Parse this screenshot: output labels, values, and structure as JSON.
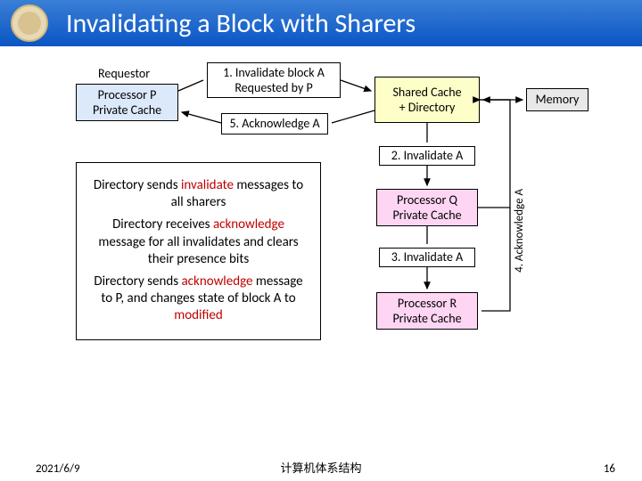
{
  "header": {
    "title": "Invalidating a Block with Sharers"
  },
  "requestor_label": "Requestor",
  "processor_p": {
    "l1": "Processor P",
    "l2": "Private Cache"
  },
  "shared_cache": {
    "l1": "Shared Cache",
    "l2": "+ Directory"
  },
  "memory": {
    "l1": "Memory"
  },
  "processor_q": {
    "l1": "Processor Q",
    "l2": "Private Cache"
  },
  "processor_r": {
    "l1": "Processor R",
    "l2": "Private Cache"
  },
  "labels": {
    "msg1a": "1. Invalidate block A",
    "msg1b": "Requested by P",
    "msg5": "5. Acknowledge A",
    "msg2": "2. Invalidate A",
    "msg3": "3. Invalidate A",
    "msg4": "4. Acknowledge  A"
  },
  "description": {
    "p1a": "Directory sends ",
    "p1b": "invalidate",
    "p1c": " messages to all sharers",
    "p2a": "Directory receives ",
    "p2b": "acknowledge",
    "p2c": " message for all invalidates and clears their presence bits",
    "p3a": "Directory sends ",
    "p3b": "acknowledge",
    "p3c": " message to P, and changes state of block A to ",
    "p3d": "modified"
  },
  "footer": {
    "date": "2021/6/9",
    "center": "计算机体系结构",
    "page": "16"
  },
  "colors": {
    "processor": "#dbe9fb",
    "directory": "#fefec8",
    "qbox": "#fed6f4",
    "rbox": "#fed6f4",
    "memory": "#e8e8e8"
  }
}
